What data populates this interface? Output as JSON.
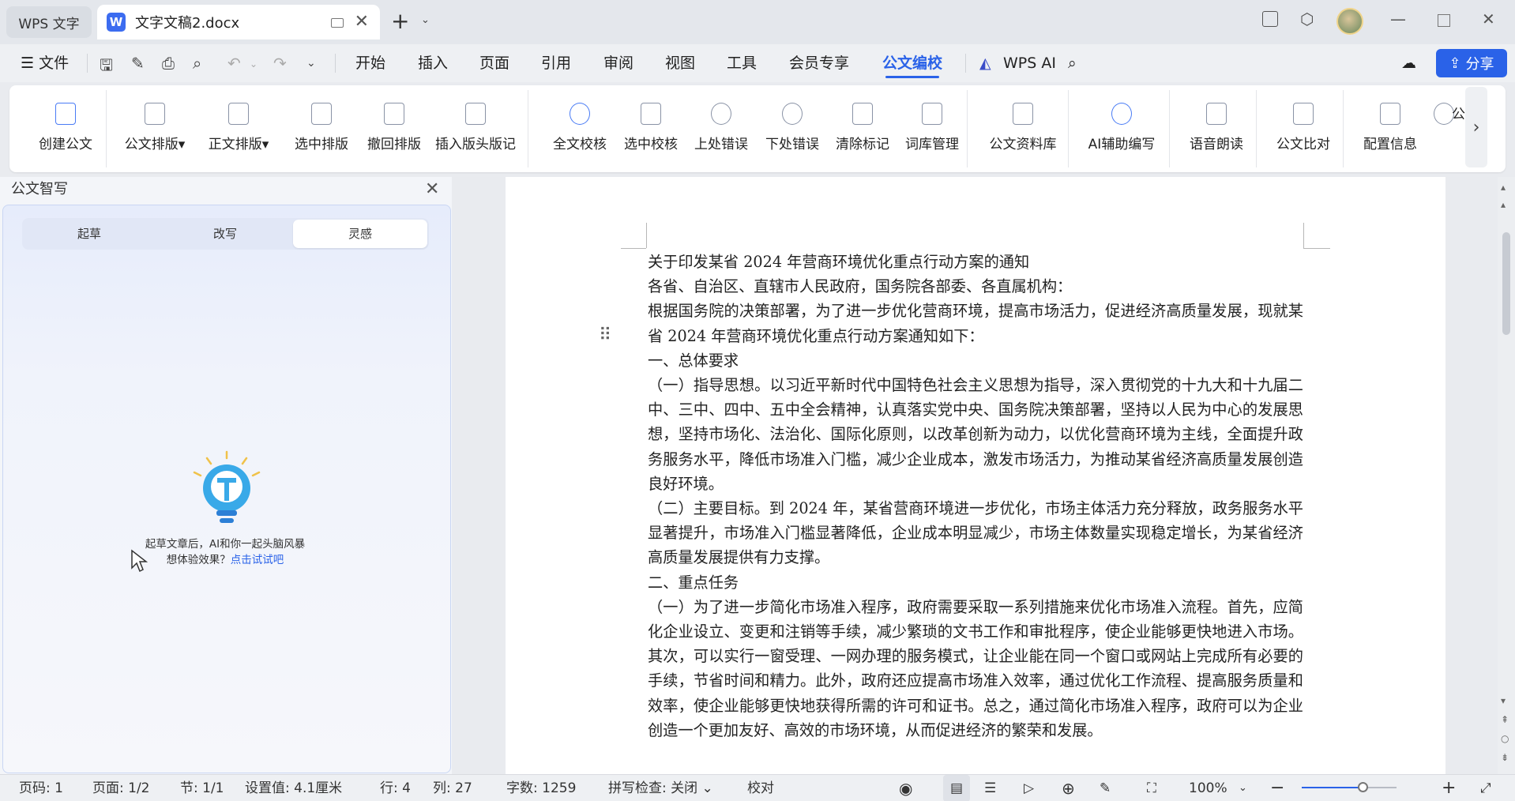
{
  "titlebar": {
    "app_tab": "WPS 文字",
    "doc_tab": "文字文稿2.docx",
    "doc_icon_letter": "W",
    "new_tab": "+"
  },
  "menubar": {
    "file": "文件",
    "menus": [
      "开始",
      "插入",
      "页面",
      "引用",
      "审阅",
      "视图",
      "工具",
      "会员专享",
      "公文编校"
    ],
    "active": "公文编校",
    "wps_ai": "WPS AI",
    "share": "分享"
  },
  "ribbon": {
    "buttons": [
      "创建公文",
      "公文排版",
      "正文排版",
      "选中排版",
      "撤回排版",
      "插入版头版记",
      "全文校核",
      "选中校核",
      "上处错误",
      "下处错误",
      "清除标记",
      "词库管理",
      "公文资料库",
      "AI辅助编写",
      "语音朗读",
      "公文比对",
      "配置信息"
    ],
    "truncated_label": "公"
  },
  "side_panel": {
    "title": "公文智写",
    "tabs": [
      "起草",
      "改写",
      "灵感"
    ],
    "selected_tab": "灵感",
    "hint_line1": "起草文章后，AI和你一起头脑风暴",
    "hint_line2_prefix": "想体验效果？",
    "hint_link": "点击试试吧"
  },
  "document": {
    "paragraphs": [
      "关于印发某省 2024 年营商环境优化重点行动方案的通知",
      "各省、自治区、直辖市人民政府，国务院各部委、各直属机构：",
      "根据国务院的决策部署，为了进一步优化营商环境，提高市场活力，促进经济高质量发展，现就某省 2024 年营商环境优化重点行动方案通知如下：",
      "一、总体要求",
      "（一）指导思想。以习近平新时代中国特色社会主义思想为指导，深入贯彻党的十九大和十九届二中、三中、四中、五中全会精神，认真落实党中央、国务院决策部署，坚持以人民为中心的发展思想，坚持市场化、法治化、国际化原则，以改革创新为动力，以优化营商环境为主线，全面提升政务服务水平，降低市场准入门槛，减少企业成本，激发市场活力，为推动某省经济高质量发展创造良好环境。",
      "（二）主要目标。到 2024 年，某省营商环境进一步优化，市场主体活力充分释放，政务服务水平显著提升，市场准入门槛显著降低，企业成本明显减少，市场主体数量实现稳定增长，为某省经济高质量发展提供有力支撑。",
      "二、重点任务",
      "（一）为了进一步简化市场准入程序，政府需要采取一系列措施来优化市场准入流程。首先，应简化企业设立、变更和注销等手续，减少繁琐的文书工作和审批程序，使企业能够更快地进入市场。其次，可以实行一窗受理、一网办理的服务模式，让企业能在同一个窗口或网站上完成所有必要的手续，节省时间和精力。此外，政府还应提高市场准入效率，通过优化工作流程、提高服务质量和效率，使企业能够更快地获得所需的许可和证书。总之，通过简化市场准入程序，政府可以为企业创造一个更加友好、高效的市场环境，从而促进经济的繁荣和发展。"
    ]
  },
  "statusbar": {
    "page_code": "页码: 1",
    "page": "页面: 1/2",
    "section": "节: 1/1",
    "setting": "设置值: 4.1厘米",
    "row": "行: 4",
    "col": "列: 27",
    "wordcount": "字数: 1259",
    "spellcheck": "拼写检查: 关闭",
    "proof": "校对",
    "zoom": "100%",
    "zoom_level_fraction": 0.65
  },
  "colors": {
    "accent": "#2a62e8",
    "titlebar_bg": "#e4e7ec",
    "page_bg": "#ffffff"
  }
}
